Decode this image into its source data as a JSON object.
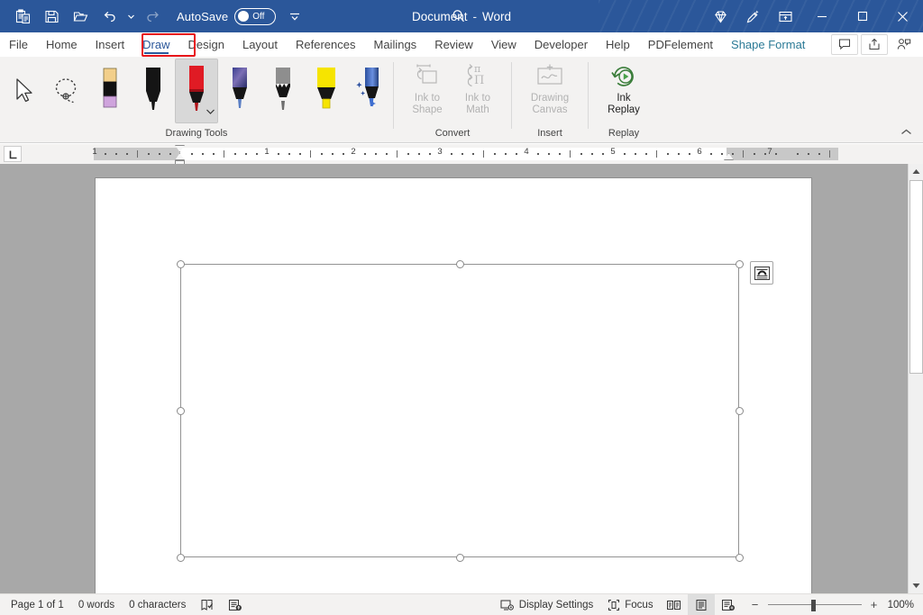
{
  "titlebar": {
    "quick_access": [
      {
        "name": "paste-icon",
        "label": "Paste"
      },
      {
        "name": "save-icon",
        "label": "Save"
      },
      {
        "name": "open-icon",
        "label": "Open"
      },
      {
        "name": "undo-icon",
        "label": "Undo"
      },
      {
        "name": "redo-icon",
        "label": "Redo"
      }
    ],
    "autosave_label": "AutoSave",
    "autosave_state": "Off",
    "customize_label": "Customize Quick Access Toolbar",
    "document_name": "Document",
    "separator": "-",
    "app_name": "Word",
    "search_label": "Search",
    "right_icons": [
      {
        "name": "diamond-icon",
        "label": "Microsoft 365"
      },
      {
        "name": "pen-sparkle-icon",
        "label": "Editor"
      },
      {
        "name": "ribbon-display-icon",
        "label": "Ribbon Display Options"
      }
    ],
    "minimize_label": "Minimize",
    "maximize_label": "Maximize",
    "close_label": "Close"
  },
  "tabs": [
    {
      "label": "File",
      "active": false,
      "contextual": false
    },
    {
      "label": "Home",
      "active": false,
      "contextual": false
    },
    {
      "label": "Insert",
      "active": false,
      "contextual": false
    },
    {
      "label": "Draw",
      "active": true,
      "contextual": false
    },
    {
      "label": "Design",
      "active": false,
      "contextual": false
    },
    {
      "label": "Layout",
      "active": false,
      "contextual": false
    },
    {
      "label": "References",
      "active": false,
      "contextual": false
    },
    {
      "label": "Mailings",
      "active": false,
      "contextual": false
    },
    {
      "label": "Review",
      "active": false,
      "contextual": false
    },
    {
      "label": "View",
      "active": false,
      "contextual": false
    },
    {
      "label": "Developer",
      "active": false,
      "contextual": false
    },
    {
      "label": "Help",
      "active": false,
      "contextual": false
    },
    {
      "label": "PDFelement",
      "active": false,
      "contextual": false
    },
    {
      "label": "Shape Format",
      "active": false,
      "contextual": true
    }
  ],
  "tab_highlight": {
    "target": "Draw",
    "color": "#e8161a"
  },
  "tabstrip_right": [
    {
      "name": "comments-button",
      "label": "Comments"
    },
    {
      "name": "share-button",
      "label": "Share"
    },
    {
      "name": "collaborate-button",
      "label": "Collaborate"
    }
  ],
  "ribbon": {
    "groups": [
      {
        "name": "drawing-tools",
        "label": "Drawing Tools",
        "tools": [
          {
            "name": "select-tool",
            "label": "Select",
            "selected": false
          },
          {
            "name": "lasso-select-tool",
            "label": "Lasso Select",
            "selected": false
          },
          {
            "name": "eraser-tool",
            "label": "Eraser",
            "selected": false
          },
          {
            "name": "pen-black-tool",
            "label": "Pen: Black",
            "selected": false
          },
          {
            "name": "pen-red-tool",
            "label": "Pen: Red",
            "selected": true
          },
          {
            "name": "pen-galaxy-tool",
            "label": "Pen: Galaxy",
            "selected": false
          },
          {
            "name": "pencil-tool",
            "label": "Pencil",
            "selected": false
          },
          {
            "name": "highlighter-yellow-tool",
            "label": "Highlighter: Yellow",
            "selected": false
          },
          {
            "name": "action-pen-tool",
            "label": "Action Pen",
            "selected": false
          }
        ]
      },
      {
        "name": "convert",
        "label": "Convert",
        "buttons": [
          {
            "name": "ink-to-shape-button",
            "line1": "Ink to",
            "line2": "Shape",
            "disabled": true
          },
          {
            "name": "ink-to-math-button",
            "line1": "Ink to",
            "line2": "Math",
            "disabled": true
          }
        ]
      },
      {
        "name": "insert",
        "label": "Insert",
        "buttons": [
          {
            "name": "drawing-canvas-button",
            "line1": "Drawing",
            "line2": "Canvas",
            "disabled": true
          }
        ]
      },
      {
        "name": "replay",
        "label": "Replay",
        "buttons": [
          {
            "name": "ink-replay-button",
            "line1": "Ink",
            "line2": "Replay",
            "disabled": false
          }
        ]
      }
    ],
    "collapse_label": "Collapse the Ribbon"
  },
  "ruler": {
    "tab_stop_label": "L",
    "numbers": [
      "1",
      "1",
      "2",
      "3",
      "4",
      "5",
      "6",
      "7"
    ],
    "unit": "inches",
    "left_indent_label": "Left Indent",
    "right_indent_label": "Right Indent"
  },
  "document": {
    "shape": {
      "name": "selected-rectangle-shape",
      "type": "rectangle",
      "handles": 8
    },
    "layout_options_label": "Layout Options",
    "layout_options_icon": "text-wrap-icon"
  },
  "scrollbar": {
    "up_label": "Scroll Up",
    "down_label": "Scroll Down",
    "thumb_label": "Vertical Scroll Thumb"
  },
  "statusbar": {
    "page": "Page 1 of 1",
    "words": "0 words",
    "characters": "0 characters",
    "proofing_label": "Proofing errors",
    "accessibility_label": "Accessibility: Good to go",
    "display_settings": "Display Settings",
    "focus": "Focus",
    "views": [
      {
        "name": "read-mode-view-button",
        "label": "Read Mode",
        "active": false
      },
      {
        "name": "print-layout-view-button",
        "label": "Print Layout",
        "active": true
      },
      {
        "name": "web-layout-view-button",
        "label": "Web Layout",
        "active": false
      }
    ],
    "zoom_out": "−",
    "zoom_in": "+",
    "zoom_level": "100%"
  },
  "colors": {
    "title_bar": "#2b579a",
    "accent": "#2b579a",
    "contextual_tab": "#2b7a96",
    "highlight_box": "#e8161a",
    "ribbon_bg": "#f3f2f1",
    "workspace_bg": "#a8a8a8",
    "page_bg": "#ffffff"
  }
}
